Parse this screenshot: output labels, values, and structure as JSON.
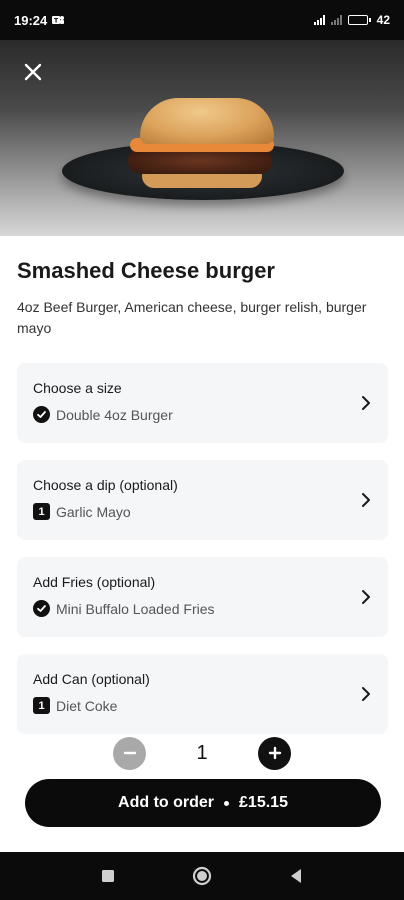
{
  "status_bar": {
    "time": "19:24",
    "battery_text": "42",
    "battery_level": 0.42
  },
  "product": {
    "title": "Smashed Cheese burger",
    "description": "4oz Beef Burger, American cheese, burger relish, burger mayo"
  },
  "options": [
    {
      "label": "Choose a size",
      "selected": "Double 4oz Burger",
      "badge": "check",
      "badge_text": ""
    },
    {
      "label": "Choose a dip (optional)",
      "selected": "Garlic Mayo",
      "badge": "number",
      "badge_text": "1"
    },
    {
      "label": "Add Fries (optional)",
      "selected": "Mini Buffalo Loaded Fries",
      "badge": "check",
      "badge_text": ""
    },
    {
      "label": "Add Can (optional)",
      "selected": "Diet Coke",
      "badge": "number",
      "badge_text": "1"
    }
  ],
  "quantity": {
    "value": "1"
  },
  "add_button": {
    "label": "Add to order",
    "price": "£15.15"
  },
  "colors": {
    "accent": "#0b0b0b",
    "card": "#f5f6f8",
    "disabled": "#a9a9a9"
  }
}
